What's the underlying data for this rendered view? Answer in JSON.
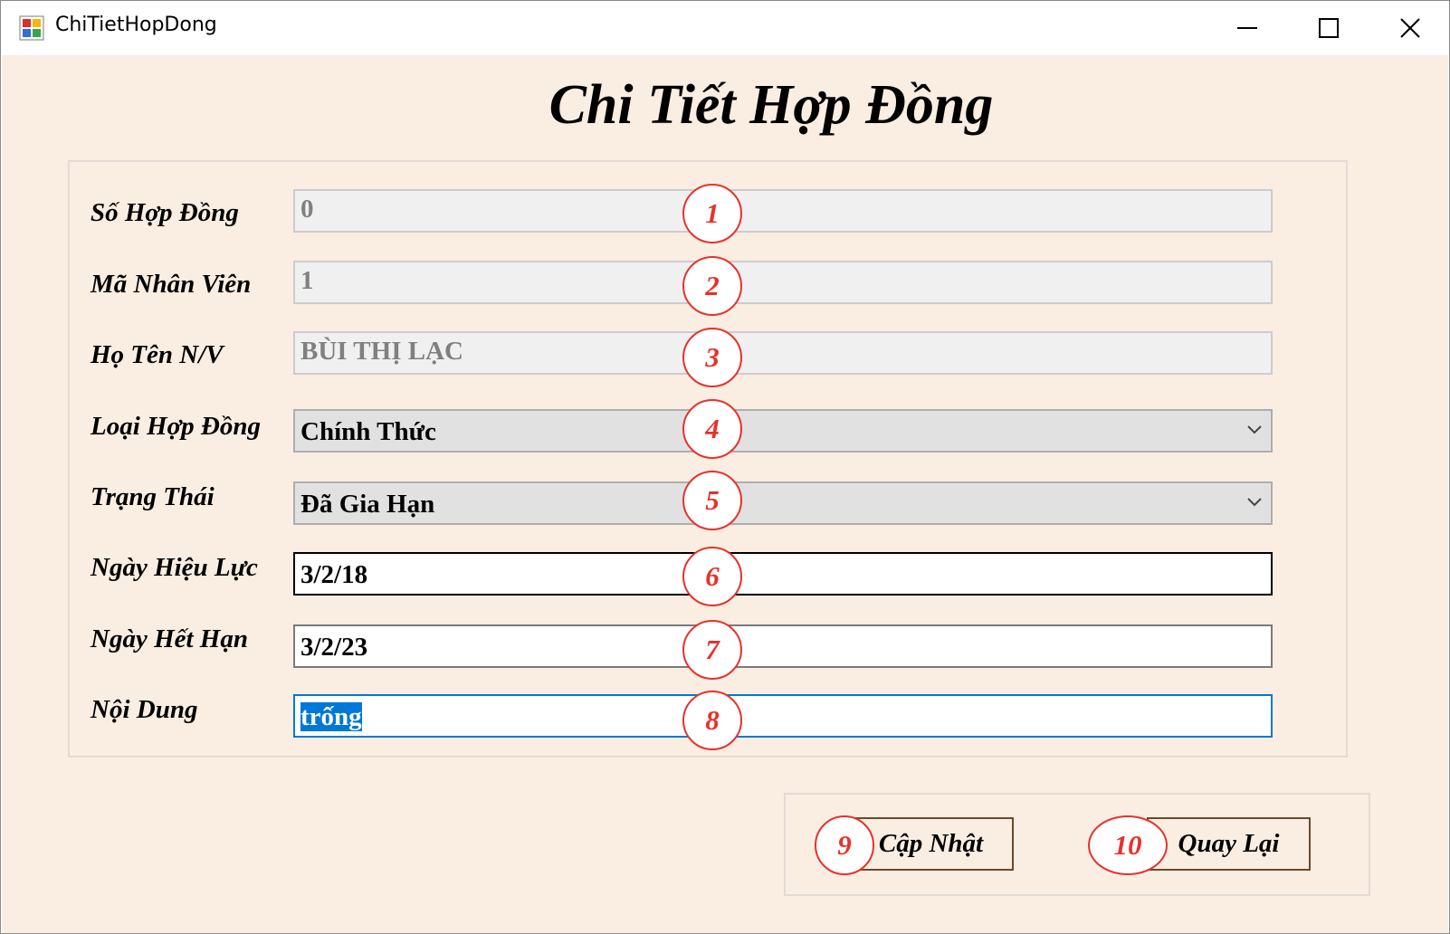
{
  "window": {
    "title": "ChiTietHopDong",
    "controls": {
      "minimize_icon": "minimize-icon",
      "maximize_icon": "maximize-icon",
      "close_icon": "close-icon"
    }
  },
  "form": {
    "heading": "Chi Tiết Hợp Đồng",
    "fields": {
      "so_hop_dong": {
        "label": "Số Hợp Đồng",
        "value": "0",
        "marker": "1"
      },
      "ma_nhan_vien": {
        "label": "Mã Nhân Viên",
        "value": "1",
        "marker": "2"
      },
      "ho_ten": {
        "label": "Họ Tên N/V",
        "value": "BÙI THỊ LẠC",
        "marker": "3"
      },
      "loai_hop_dong": {
        "label": "Loại Hợp Đồng",
        "value": "Chính Thức",
        "marker": "4"
      },
      "trang_thai": {
        "label": "Trạng Thái",
        "value": "Đã Gia Hạn",
        "marker": "5"
      },
      "ngay_hieu_luc": {
        "label": "Ngày Hiệu Lực",
        "value": "3/2/18",
        "marker": "6"
      },
      "ngay_het_han": {
        "label": "Ngày Hết Hạn",
        "value": "3/2/23",
        "marker": "7"
      },
      "noi_dung": {
        "label": "Nội Dung",
        "value": "trống",
        "marker": "8"
      }
    }
  },
  "buttons": {
    "update": {
      "label": "Cập Nhật",
      "marker": "9"
    },
    "back": {
      "label": "Quay Lại",
      "marker": "10"
    }
  },
  "colors": {
    "background": "#faede2",
    "marker": "#e8312a",
    "focus_border": "#0078d7",
    "button_border": "#6b4a2a"
  }
}
